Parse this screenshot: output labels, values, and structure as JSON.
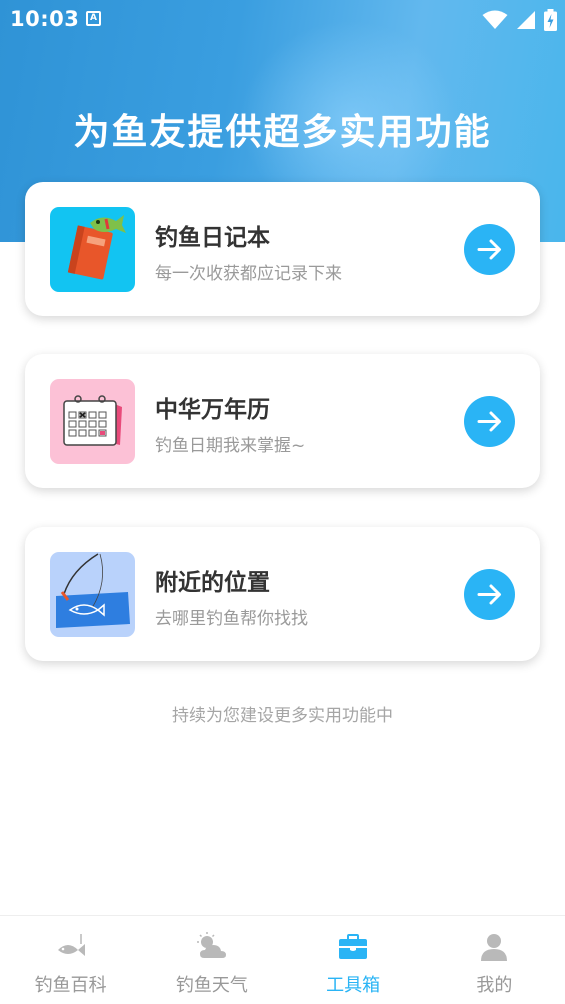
{
  "status_bar": {
    "time": "10:03",
    "notification_icon": "A"
  },
  "hero": {
    "title": "为鱼友提供超多实用功能"
  },
  "cards": [
    {
      "title": "钓鱼日记本",
      "subtitle": "每一次收获都应记录下来",
      "icon": "notebook-icon",
      "color": "#12c4f2"
    },
    {
      "title": "中华万年历",
      "subtitle": "钓鱼日期我来掌握~",
      "icon": "calendar-icon",
      "color": "#fcc1d6"
    },
    {
      "title": "附近的位置",
      "subtitle": "去哪里钓鱼帮你找找",
      "icon": "fishing-spot-icon",
      "color": "#b9d2fb"
    }
  ],
  "footer_note": "持续为您建设更多实用功能中",
  "tabs": [
    {
      "label": "钓鱼百科",
      "icon": "fish-icon",
      "active": false
    },
    {
      "label": "钓鱼天气",
      "icon": "weather-icon",
      "active": false
    },
    {
      "label": "工具箱",
      "icon": "toolbox-icon",
      "active": true
    },
    {
      "label": "我的",
      "icon": "user-icon",
      "active": false
    }
  ],
  "colors": {
    "accent": "#2ab4f5",
    "hero_start": "#2f93d6",
    "hero_end": "#49b6ec"
  }
}
